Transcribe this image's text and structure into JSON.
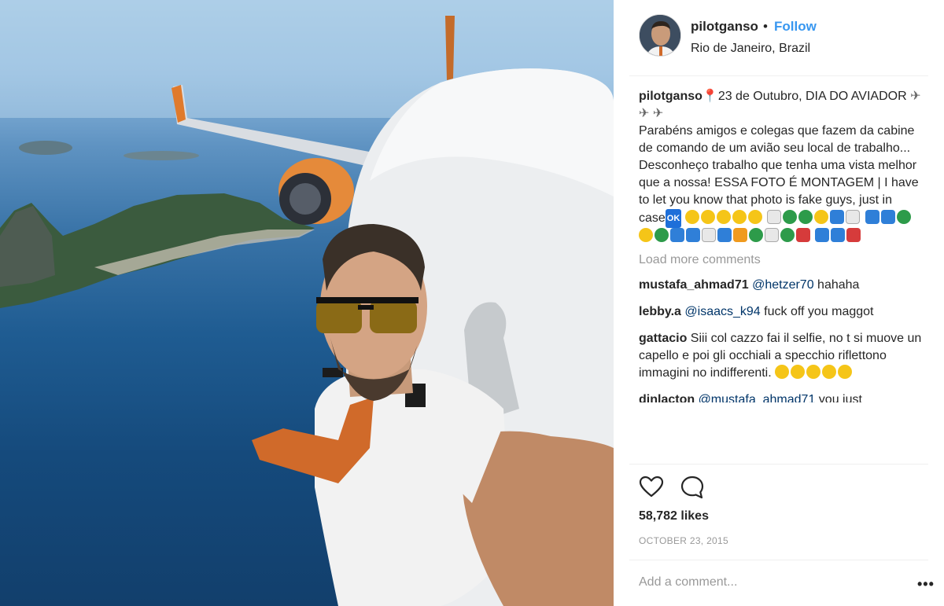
{
  "post": {
    "username": "pilotganso",
    "separator": "•",
    "follow_label": "Follow",
    "location": "Rio de Janeiro, Brazil"
  },
  "caption": {
    "username": "pilotganso",
    "line1": "23 de Outubro, DIA DO AVIADOR",
    "body": "Parabéns amigos e colegas que fazem da cabine de comando de um avião seu local de trabalho... Desconheço trabalho que tenha uma vista melhor que a nossa! ESSA FOTO É MONTAGEM | I have to let you know that photo is fake guys, just in case",
    "ok_emoji": "OK"
  },
  "load_more_label": "Load more comments",
  "comments": [
    {
      "username": "mustafa_ahmad71",
      "mention": "@hetzer70",
      "text": "hahaha"
    },
    {
      "username": "lebby.a",
      "mention": "@isaacs_k94",
      "text": "fuck off you maggot"
    },
    {
      "username": "gattacio",
      "mention": "",
      "text": "Siii col cazzo fai il selfie, no t si muove un capello e poi gli occhiali a specchio riflettono immagini no indifferenti."
    },
    {
      "username": "dinlacton",
      "mention": "@mustafa_ahmad71",
      "text": "you just"
    }
  ],
  "likes": "58,782 likes",
  "date": "OCTOBER 23, 2015",
  "add_comment_placeholder": "Add a comment...",
  "more_label": "•••",
  "icons": {
    "like": "heart-icon",
    "comment": "comment-bubble-icon",
    "location_pin": "pin-emoji",
    "plane": "airplane-emoji"
  },
  "colors": {
    "follow": "#3897f0",
    "text": "#262626",
    "muted": "#999999",
    "mention": "#003569"
  }
}
